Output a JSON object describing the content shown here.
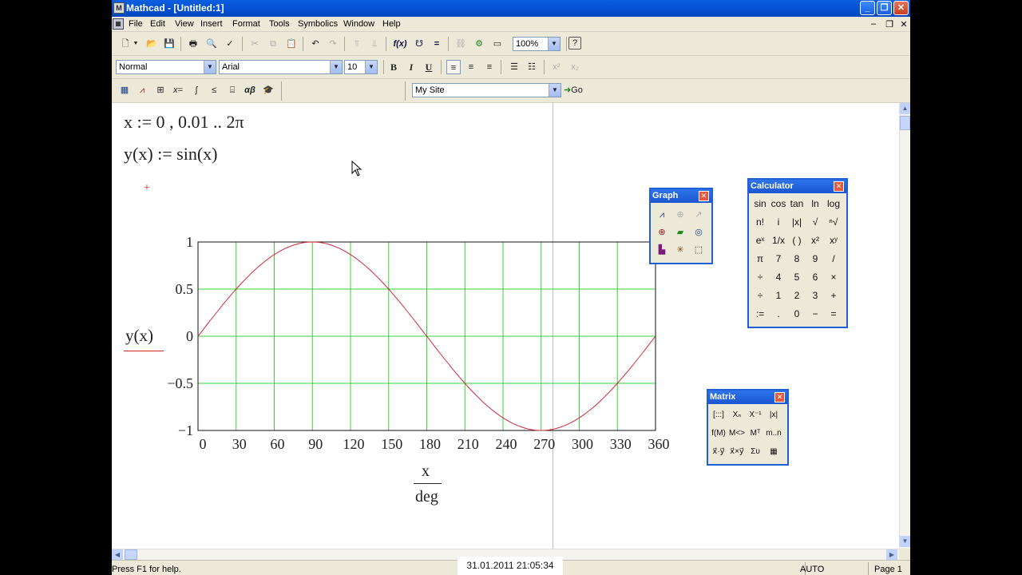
{
  "window": {
    "title": "Mathcad - [Untitled:1]",
    "app_icon": "mathcad-icon"
  },
  "menu": [
    "File",
    "Edit",
    "View",
    "Insert",
    "Format",
    "Tools",
    "Symbolics",
    "Window",
    "Help"
  ],
  "toolbar1": {
    "zoom": "100%"
  },
  "toolbar2": {
    "style": "Normal",
    "font": "Arial",
    "size": "10",
    "bold": "B",
    "italic": "I",
    "underline": "U"
  },
  "toolbar3": {
    "site": "My Site",
    "go": "Go"
  },
  "worksheet": {
    "line1": "x := 0 , 0.01 .. 2π",
    "line2": "y(x) := sin(x)",
    "placeholder_cross": "+",
    "y_axis_label": "y(x)",
    "x_axis_numerator": "x",
    "x_axis_denominator": "deg"
  },
  "chart_data": {
    "type": "line",
    "series": [
      {
        "name": "",
        "function": "sin(x)",
        "color": "#cc2a3a"
      }
    ],
    "x_range": [
      0,
      360
    ],
    "ylim": [
      -1,
      1
    ],
    "x_ticks": [
      "0",
      "30",
      "60",
      "90",
      "120",
      "150",
      "180",
      "210",
      "240",
      "270",
      "300",
      "330",
      "360"
    ],
    "y_ticks": [
      "1",
      "0.5",
      "0",
      "-0.5",
      "-1"
    ],
    "grid": true,
    "grid_color": "#3ad03a"
  },
  "palettes": {
    "graph": {
      "title": "Graph",
      "buttons": [
        "xy-plot-icon",
        "polar-plot-icon",
        "surface-plot-icon",
        "contour-plot-icon",
        "3d-bar-icon",
        "scatter-icon",
        "vector-field-icon",
        "zoom-icon",
        "trace-icon"
      ]
    },
    "calculator": {
      "title": "Calculator",
      "rows": [
        [
          "sin",
          "cos",
          "tan",
          "ln",
          "log"
        ],
        [
          "n!",
          "i",
          "|x|",
          "√",
          "ⁿ√"
        ],
        [
          "eˣ",
          "1/x",
          "( )",
          "x²",
          "xʸ"
        ],
        [
          "π",
          "7",
          "8",
          "9",
          "/"
        ],
        [
          "÷",
          "4",
          "5",
          "6",
          "×"
        ],
        [
          "÷",
          "1",
          "2",
          "3",
          "+"
        ],
        [
          ":=",
          ".",
          "0",
          "−",
          "="
        ]
      ]
    },
    "matrix": {
      "title": "Matrix",
      "rows": [
        [
          "[:::]",
          "Xₙ",
          "X⁻¹",
          "|x|"
        ],
        [
          "f(M)",
          "M<>",
          "Mᵀ",
          "m..n"
        ],
        [
          "x⃗·y⃗",
          "x⃗×y⃗",
          "Συ",
          "▦"
        ]
      ]
    }
  },
  "status": {
    "help": "Press F1 for help.",
    "timestamp": "31.01.2011 21:05:34",
    "mode": "AUTO",
    "page": "Page 1"
  }
}
